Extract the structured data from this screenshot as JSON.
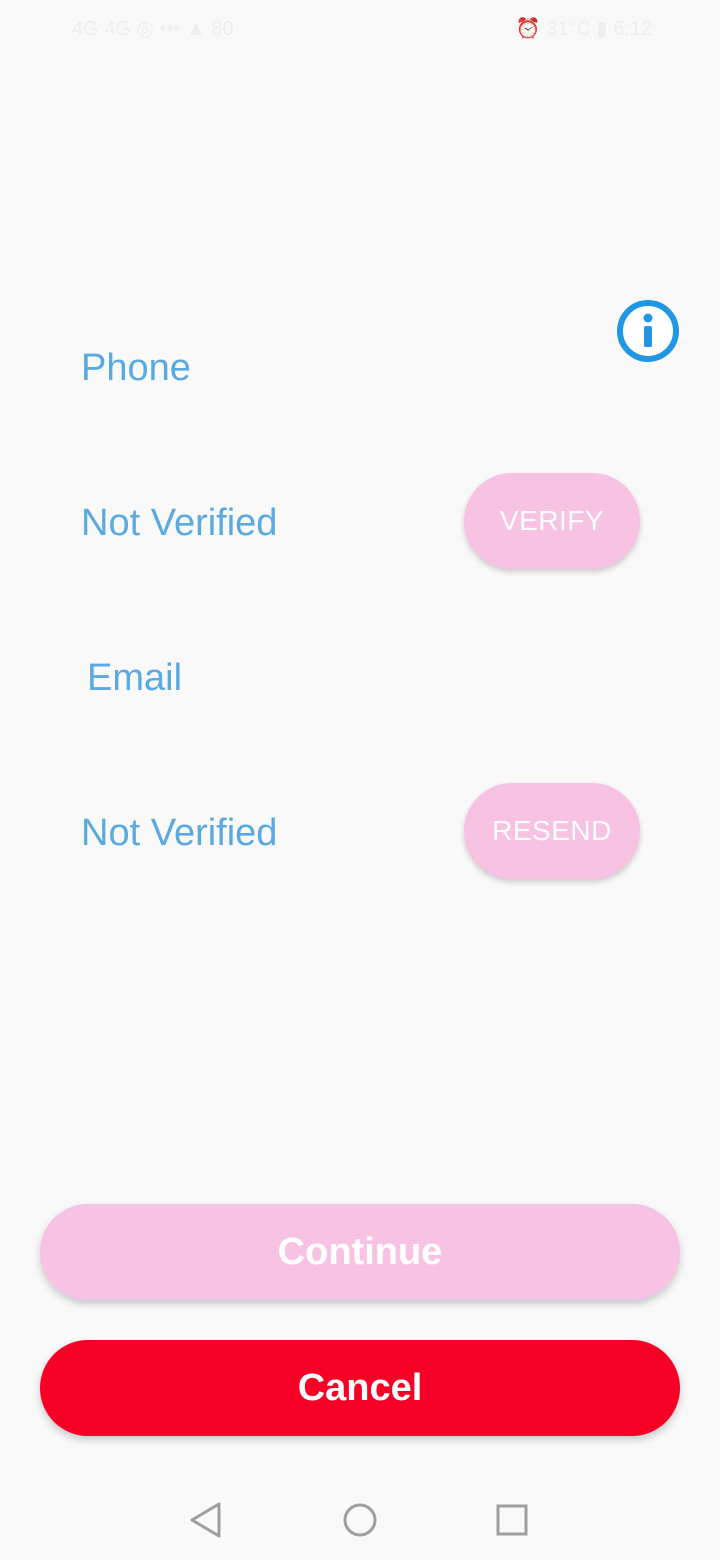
{
  "status_bar": {
    "left_text": "4G 4G ◎ ••• ▲ 80",
    "right_text": "⏰ 31°C ▮ 6:12"
  },
  "colors": {
    "accent_text": "#5aa9e0",
    "pill_button": "#f8c3e3",
    "cancel_button": "#f60026",
    "info_icon": "#2196e3",
    "background": "#f9f9f9"
  },
  "info": {
    "icon": "info-icon"
  },
  "phone": {
    "label": "Phone",
    "status": "Not Verified",
    "action_label": "VERIFY"
  },
  "email": {
    "label": "Email",
    "status": "Not Verified",
    "action_label": "RESEND"
  },
  "actions": {
    "continue_label": "Continue",
    "cancel_label": "Cancel"
  },
  "nav": {
    "back_icon": "back-triangle-icon",
    "home_icon": "home-circle-icon",
    "recent_icon": "recent-square-icon"
  }
}
